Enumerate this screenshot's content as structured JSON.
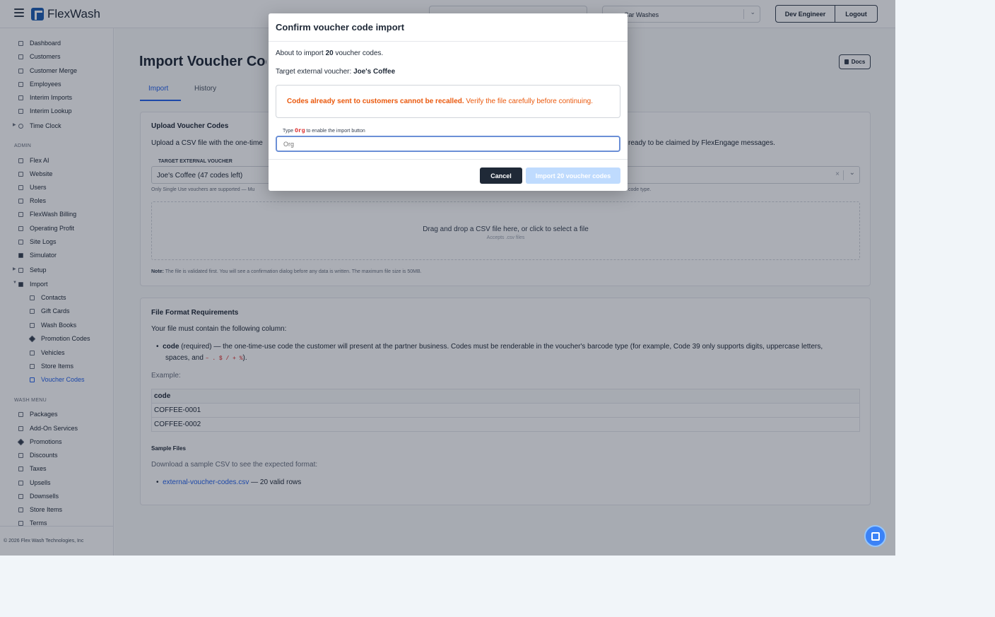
{
  "brand": "FlexWash",
  "topbar": {
    "site_select": "Car Washes",
    "user_button": "Dev Engineer",
    "logout_button": "Logout"
  },
  "sidebar": {
    "main_items": [
      {
        "label": "Dashboard"
      },
      {
        "label": "Customers"
      },
      {
        "label": "Customer Merge"
      },
      {
        "label": "Employees"
      },
      {
        "label": "Interim Imports"
      },
      {
        "label": "Interim Lookup"
      },
      {
        "label": "Time Clock"
      }
    ],
    "admin_header": "ADMIN",
    "admin_items": [
      {
        "label": "Flex AI"
      },
      {
        "label": "Website"
      },
      {
        "label": "Users"
      },
      {
        "label": "Roles"
      },
      {
        "label": "FlexWash Billing"
      },
      {
        "label": "Operating Profit"
      },
      {
        "label": "Site Logs"
      },
      {
        "label": "Simulator"
      },
      {
        "label": "Setup"
      },
      {
        "label": "Import"
      }
    ],
    "import_items": [
      {
        "label": "Contacts"
      },
      {
        "label": "Gift Cards"
      },
      {
        "label": "Wash Books"
      },
      {
        "label": "Promotion Codes"
      },
      {
        "label": "Vehicles"
      },
      {
        "label": "Store Items"
      },
      {
        "label": "Voucher Codes"
      }
    ],
    "wash_menu_header": "WASH MENU",
    "wash_items": [
      {
        "label": "Packages"
      },
      {
        "label": "Add-On Services"
      },
      {
        "label": "Promotions"
      },
      {
        "label": "Discounts"
      },
      {
        "label": "Taxes"
      },
      {
        "label": "Upsells"
      },
      {
        "label": "Downsells"
      },
      {
        "label": "Store Items"
      },
      {
        "label": "Terms"
      }
    ],
    "copyright": "© 2026 Flex Wash Technologies, Inc"
  },
  "page": {
    "title": "Import Voucher Codes",
    "docs_button": "Docs",
    "tabs": [
      {
        "label": "Import"
      },
      {
        "label": "History"
      }
    ],
    "upload": {
      "heading": "Upload Voucher Codes",
      "desc_left": "Upload a CSV file with the one-time",
      "desc_right": "ready to be claimed by FlexEngage messages.",
      "field_label": "TARGET EXTERNAL VOUCHER",
      "field_value": "Joe's Coffee (47 codes left)",
      "hint_left": "Only Single Use vouchers are supported — Mu",
      "hint_right": "code type.",
      "dropzone_text": "Drag and drop a CSV file here, or click to select a file",
      "dropzone_sub": "Accepts .csv files",
      "note_label": "Note:",
      "note_text": "The file is validated first. You will see a confirmation dialog before any data is written. The maximum file size is 50MB."
    },
    "format": {
      "heading": "File Format Requirements",
      "intro": "Your file must contain the following column:",
      "col_name": "code",
      "col_desc_1": "(required) — the one-time-use code the customer will present at the partner business. Codes must be renderable in the voucher's barcode type (for example, Code 39 only supports digits, uppercase letters,",
      "col_desc_2a": "spaces, and",
      "col_desc_2_code": "– . $ / + %",
      "col_desc_2b": ").",
      "example_label": "Example:",
      "table_header": "code",
      "table_rows": [
        "COFFEE-0001",
        "COFFEE-0002"
      ],
      "sample_heading": "Sample Files",
      "sample_desc": "Download a sample CSV to see the expected format:",
      "sample_link": "external-voucher-codes.csv",
      "sample_suffix": "— 20 valid rows"
    }
  },
  "modal": {
    "title": "Confirm voucher code import",
    "about_prefix": "About to import",
    "about_count": "20",
    "about_suffix": "voucher codes.",
    "target_prefix": "Target external voucher:",
    "target_name": "Joe's Coffee",
    "warning_bold": "Codes already sent to customers cannot be recalled.",
    "warning_rest": "Verify the file carefully before continuing.",
    "type_prefix": "Type",
    "type_word": "Org",
    "type_suffix": "to enable the import button",
    "input_placeholder": "Org",
    "cancel_button": "Cancel",
    "confirm_button": "Import 20 voucher codes"
  }
}
